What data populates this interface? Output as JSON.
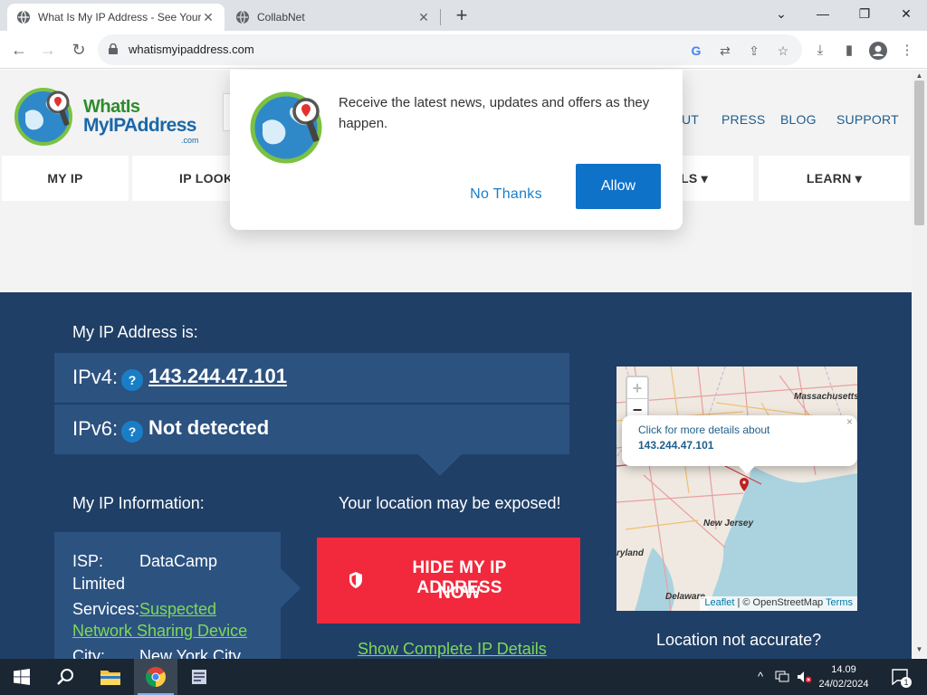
{
  "browser": {
    "tabs": [
      {
        "title": "What Is My IP Address - See Your",
        "active": true
      },
      {
        "title": "CollabNet",
        "active": false
      }
    ],
    "new_tab_symbol": "+",
    "window_controls": {
      "dropdown": "⌄",
      "minimize": "—",
      "maximize": "❐",
      "close": "✕"
    },
    "url": "whatismyipaddress.com",
    "icons": [
      "back-icon",
      "forward-icon",
      "reload-icon",
      "lock-icon",
      "google-icon",
      "translate-icon",
      "share-icon",
      "star-icon",
      "download-icon",
      "side-panel-icon",
      "profile-icon",
      "menu-icon"
    ]
  },
  "site": {
    "logo": {
      "line1": "WhatIs",
      "line2": "MyIPAddress",
      "line3": ".com"
    },
    "top_nav": [
      "UT",
      "PRESS",
      "BLOG",
      "SUPPORT"
    ],
    "main_nav": [
      "MY IP",
      "IP LOOK",
      "LS ▾",
      "LEARN ▾"
    ]
  },
  "notification_prompt": {
    "message": "Receive the latest news, updates and offers as they happen.",
    "no_thanks": "No Thanks",
    "allow": "Allow"
  },
  "ip_section": {
    "heading": "My IP Address is:",
    "ipv4_label": "IPv4:",
    "ipv4_value": "143.244.47.101",
    "ipv6_label": "IPv6:",
    "ipv6_value": "Not detected",
    "help_symbol": "?"
  },
  "info_section": {
    "heading": "My IP Information:",
    "isp_label": "ISP:",
    "isp_value": "DataCamp",
    "isp_value_cont": "Limited",
    "services_label": "Services:",
    "services_value_line1": "Suspected",
    "services_value_line2": "Network Sharing Device",
    "city_label": "City:",
    "city_value": "New York City"
  },
  "cta": {
    "warning": "Your location may be exposed!",
    "button_line1": "HIDE MY IP ADDRESS",
    "button_line2": "NOW",
    "show_details": "Show Complete IP Details"
  },
  "map": {
    "zoom_in": "+",
    "zoom_out": "−",
    "popup_line1": "Click for more details about",
    "popup_line2": "143.244.47.101",
    "popup_close": "×",
    "labels": {
      "massachusetts": "Massachusetts",
      "new_jersey": "New Jersey",
      "maryland": "ryland",
      "delaware": "Delaware"
    },
    "attribution_leaflet": "Leaflet",
    "attribution_sep": " | © OpenStreetMap ",
    "attribution_terms": "Terms",
    "location_not_accurate": "Location not accurate?"
  },
  "taskbar": {
    "apps": [
      "windows-start-icon",
      "search-icon",
      "file-explorer-icon",
      "chrome-icon",
      "app-icon"
    ],
    "time": "14.09",
    "date": "24/02/2024",
    "notification_count": "1"
  },
  "colors": {
    "brand_blue": "#1f3f66",
    "panel_blue": "#2c5280",
    "cta_red": "#f2283c",
    "link_green": "#7ed957",
    "allow_blue": "#0f72c9"
  }
}
